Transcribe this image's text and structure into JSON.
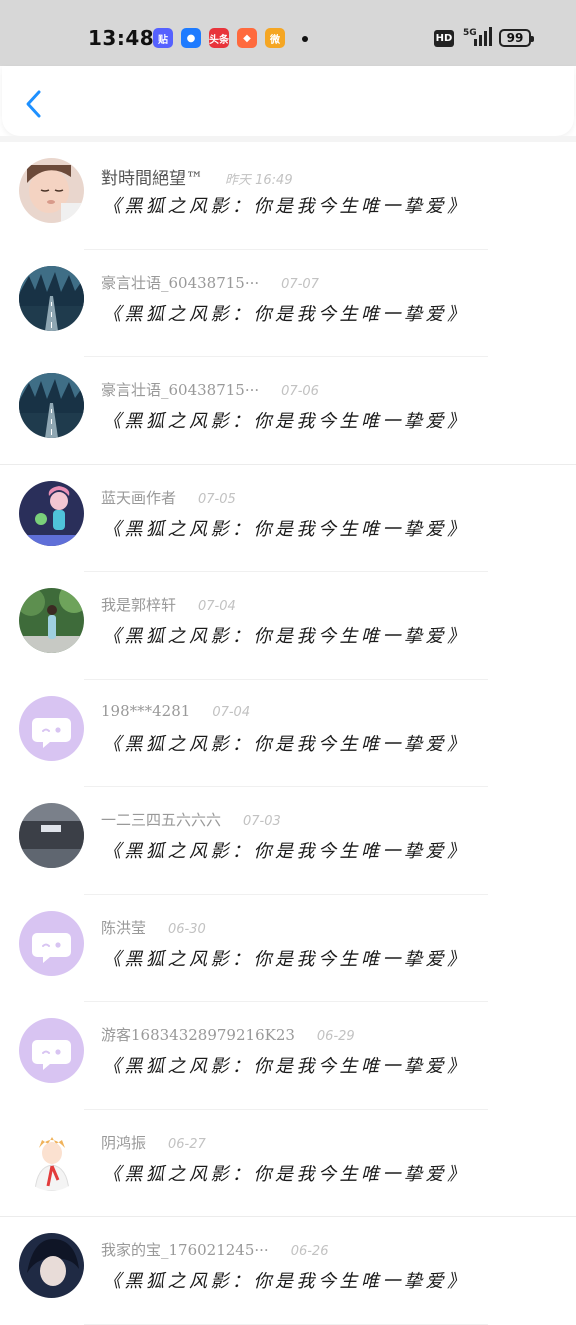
{
  "status_bar": {
    "time": "13:48",
    "network": "5G",
    "hd": "HD",
    "battery": "99",
    "notification_icons": [
      {
        "icon": "app-notification-icon",
        "color": "#5561ff",
        "text": "贴"
      },
      {
        "icon": "app-notification-icon",
        "color": "#1e7bff",
        "text": "●"
      },
      {
        "icon": "toutiao-icon",
        "color": "#e8343b",
        "text": "头条"
      },
      {
        "icon": "app-notification-icon",
        "color": "#ff6a3d",
        "text": "◆"
      },
      {
        "icon": "weibo-icon",
        "color": "#f5a623",
        "text": "微"
      }
    ]
  },
  "header": {
    "back_icon": "chevron-left-icon",
    "accent": "#1e90ff"
  },
  "comments": [
    {
      "user": "對時間絕望™",
      "date": "昨天 16:49",
      "text": "《黑狐之风影：你是我今生唯一挚爱》",
      "avatar": "photo-child"
    },
    {
      "user": "豪言壮语_60438715···",
      "date": "07-07",
      "text": "《黑狐之风影：你是我今生唯一挚爱》",
      "avatar": "photo-road"
    },
    {
      "user": "豪言壮语_60438715···",
      "date": "07-06",
      "text": "《黑狐之风影：你是我今生唯一挚爱》",
      "avatar": "photo-road"
    },
    {
      "user": "蓝天画作者",
      "date": "07-05",
      "text": "《黑狐之风影：你是我今生唯一挚爱》",
      "avatar": "photo-anime"
    },
    {
      "user": "我是郭梓轩",
      "date": "07-04",
      "text": "《黑狐之风影：你是我今生唯一挚爱》",
      "avatar": "photo-garden"
    },
    {
      "user": "198***4281",
      "date": "07-04",
      "text": "《黑狐之风影：你是我今生唯一挚爱》",
      "avatar": "default-chat"
    },
    {
      "user": "一二三四五六六六",
      "date": "07-03",
      "text": "《黑狐之风影：你是我今生唯一挚爱》",
      "avatar": "photo-building"
    },
    {
      "user": "陈洪莹",
      "date": "06-30",
      "text": "《黑狐之风影：你是我今生唯一挚爱》",
      "avatar": "default-chat"
    },
    {
      "user": "游客16834328979216K23",
      "date": "06-29",
      "text": "《黑狐之风影：你是我今生唯一挚爱》",
      "avatar": "default-chat"
    },
    {
      "user": "阴鸿振",
      "date": "06-27",
      "text": "《黑狐之风影：你是我今生唯一挚爱》",
      "avatar": "photo-anime-boy"
    },
    {
      "user": "我家的宝_176021245···",
      "date": "06-26",
      "text": "《黑狐之风影：你是我今生唯一挚爱》",
      "avatar": "photo-anime-dark"
    }
  ],
  "colors": {
    "default_avatar": "#d8c4f2",
    "username": "#999999",
    "date": "#c2c2c2"
  }
}
